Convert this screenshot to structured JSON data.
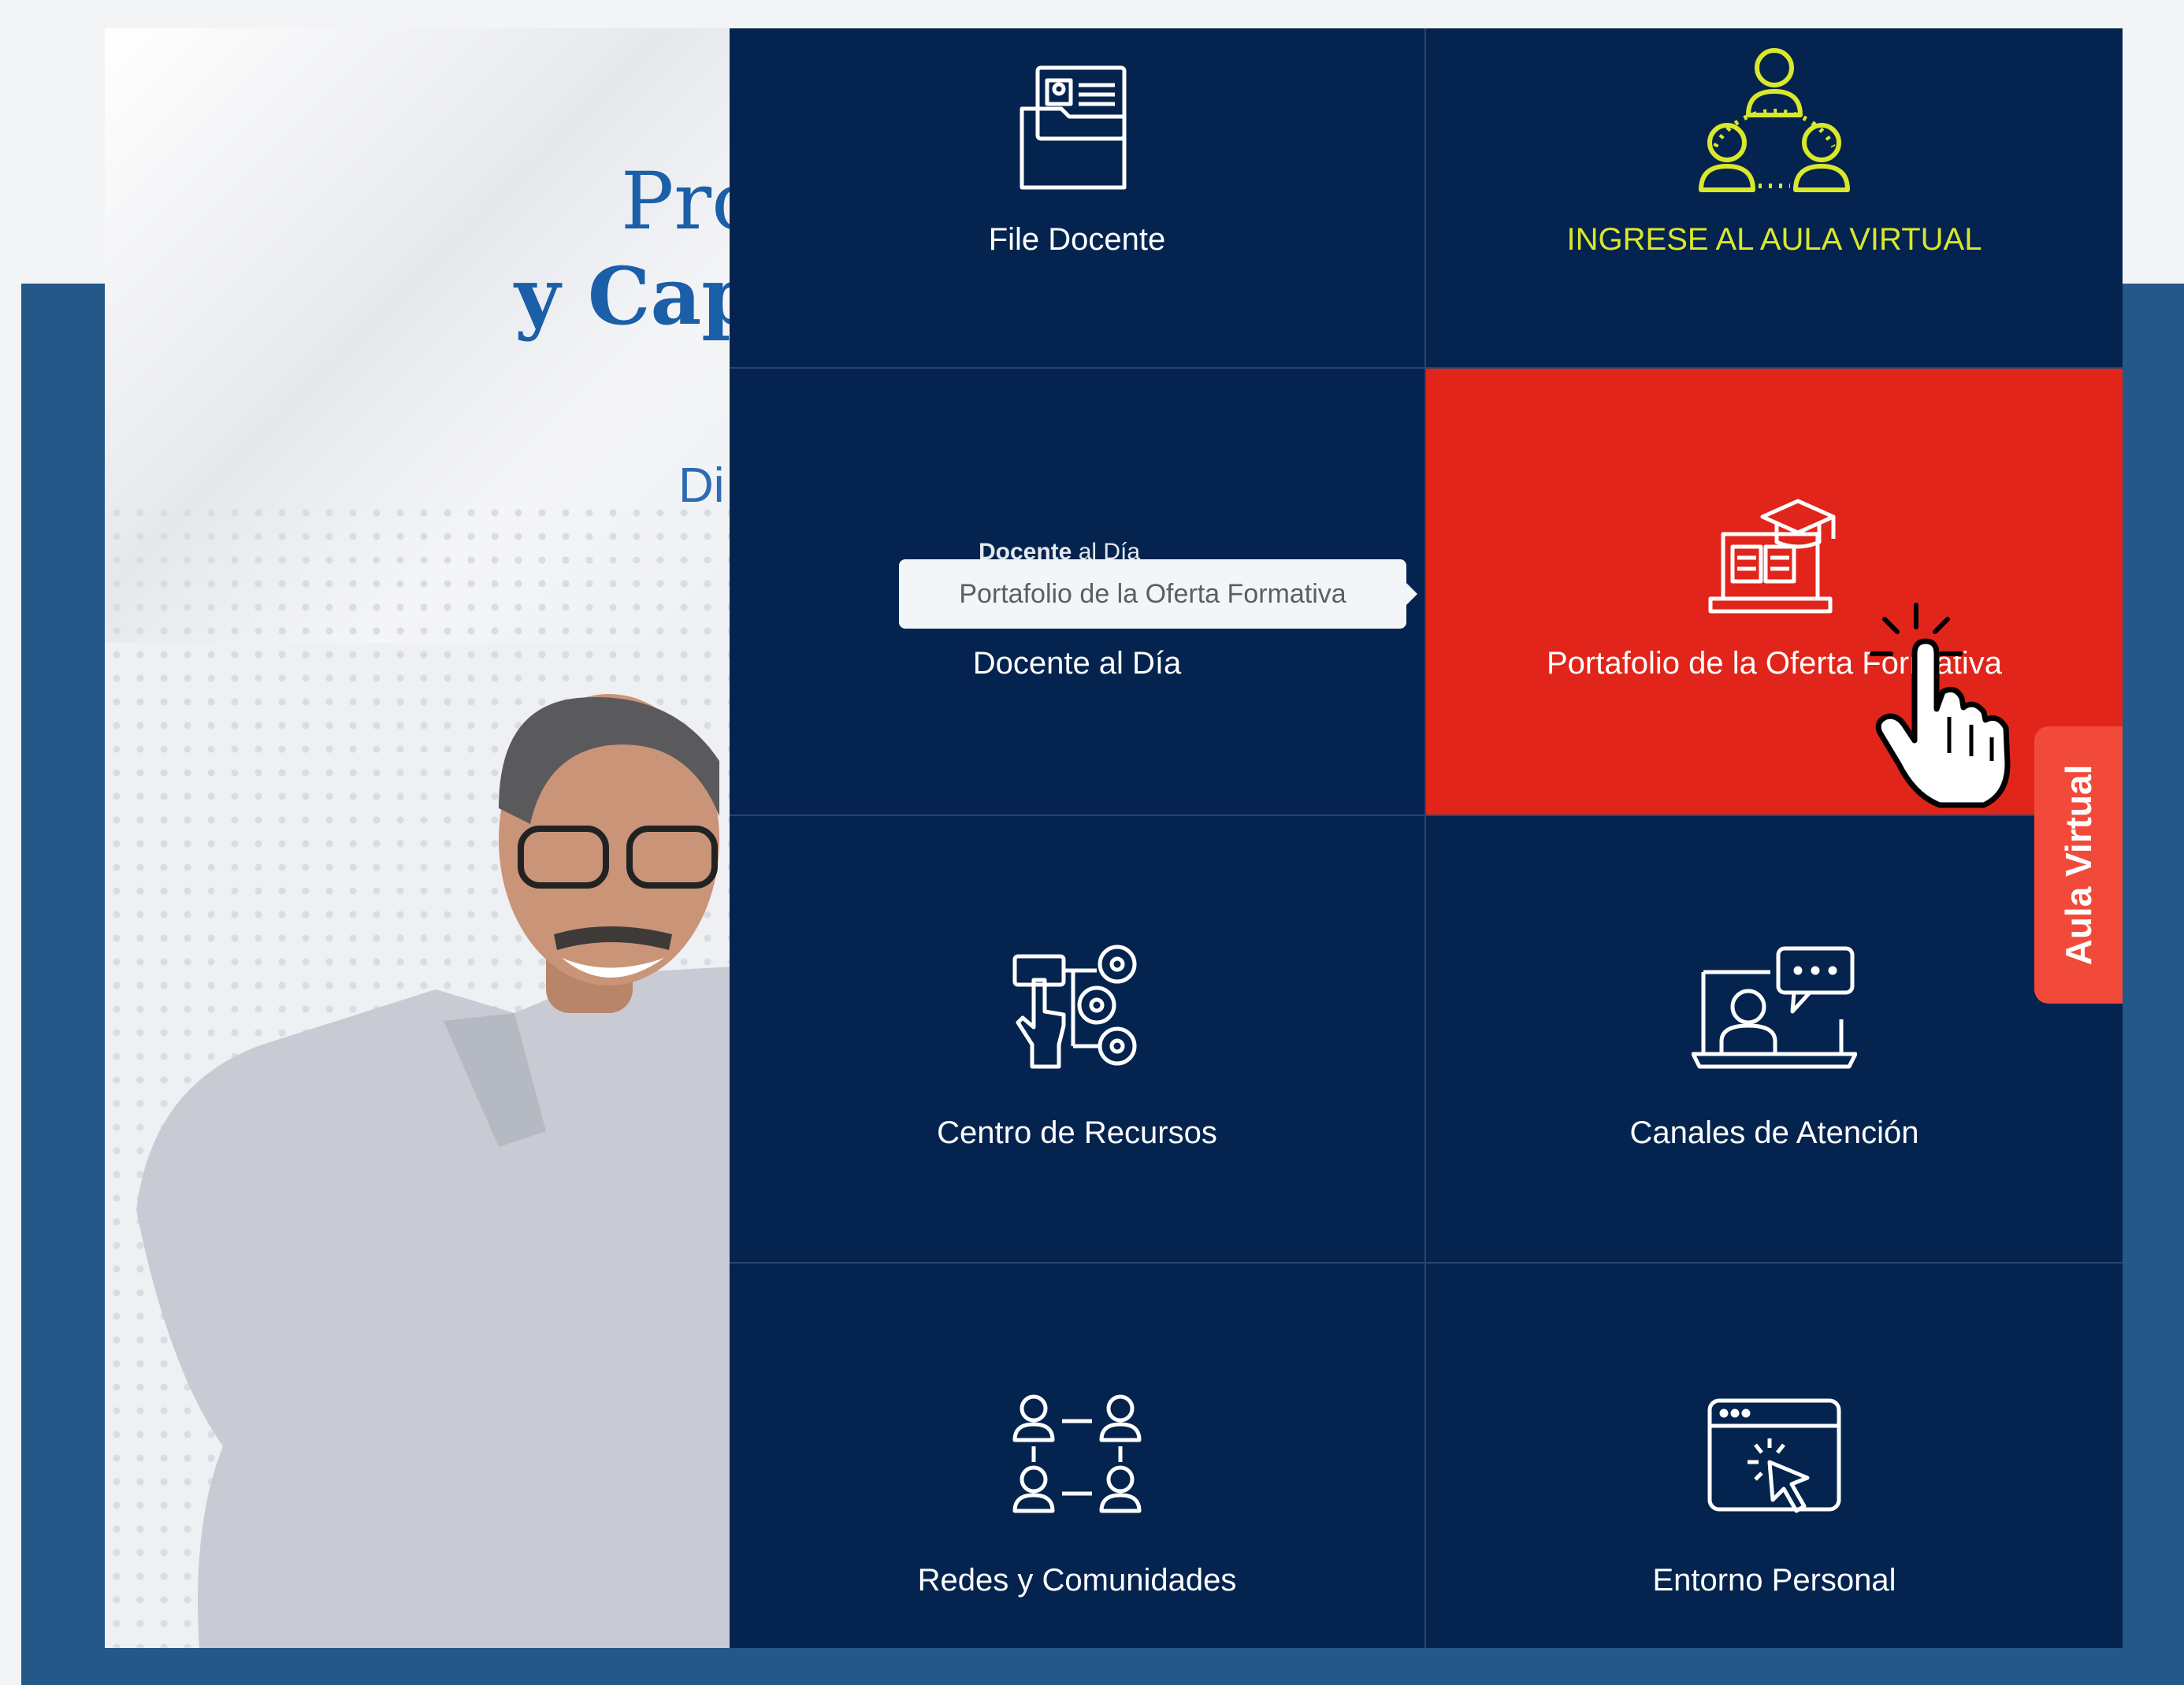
{
  "hero": {
    "title_line1": "Progr",
    "title_line2": "y Capac",
    "subtitle": "Di"
  },
  "menu": {
    "tiles": [
      {
        "label": "File Docente",
        "icon": "file-folder-icon"
      },
      {
        "label": "INGRESE AL AULA VIRTUAL",
        "icon": "virtual-classroom-icon"
      },
      {
        "label": "Docente al Día",
        "icon": "none"
      },
      {
        "label": "Portafolio de la Oferta Formativa",
        "icon": "laptop-graduation-icon"
      },
      {
        "label": "Centro de Recursos",
        "icon": "resource-center-icon"
      },
      {
        "label": "Canales de Atención",
        "icon": "video-chat-icon"
      },
      {
        "label": "Redes y Comunidades",
        "icon": "network-people-icon"
      },
      {
        "label": "Entorno Personal",
        "icon": "browser-click-icon"
      }
    ],
    "ghost_bold": "Docente",
    "ghost_rest": " al Día"
  },
  "tooltip": {
    "text": "Portafolio de la Oferta Formativa"
  },
  "side_tab": {
    "label": "Aula Virtual"
  },
  "colors": {
    "navy": "#04244f",
    "active_red": "#e1251b",
    "yellow": "#d9e82c",
    "band_blue": "#245888",
    "tab_red": "#f24a3a"
  }
}
